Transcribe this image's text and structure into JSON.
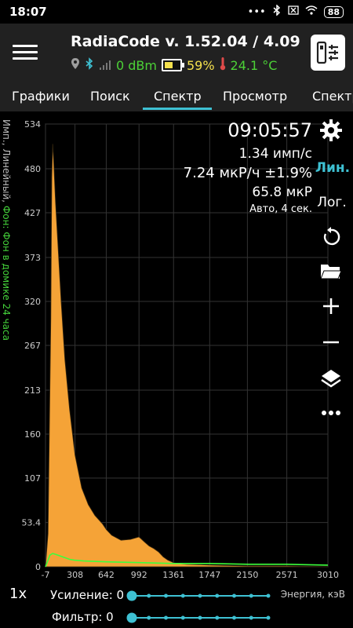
{
  "status": {
    "time": "18:07",
    "icons": [
      "more-dots-icon",
      "bluetooth-icon",
      "close-box-icon",
      "wifi-icon",
      "battery-icon"
    ],
    "battery": "88"
  },
  "appbar": {
    "title": "RadiaCode v. 1.52.04 / 4.09",
    "signal": "0 dBm",
    "battery": "59%",
    "temperature": "24.1 °C",
    "icons": [
      "location-pin-icon",
      "bluetooth-icon",
      "signal-bars-icon",
      "battery-icon",
      "thermometer-icon",
      "device-settings-icon"
    ]
  },
  "tabs": [
    "Графики",
    "Поиск",
    "Спектр",
    "Просмотр",
    "Спектр"
  ],
  "active_tab": 2,
  "spectrum": {
    "vertical_label_a": "Имп., Линейный, ",
    "vertical_label_b": "Фон: Фон в домике 24 часа",
    "time": "09:05:57",
    "count_rate": "1.34 имп/с",
    "dose_rate": "7.24 мкР/ч ±1.9%",
    "total_dose": "65.8 мкР",
    "mode": "Авто, 4 сек.",
    "side": {
      "lin": "Лин.",
      "log": "Лог.",
      "icons": [
        "gear-icon",
        "refresh-icon",
        "folder-icon",
        "plus-icon",
        "minus-icon",
        "layers-icon",
        "more-icon"
      ]
    }
  },
  "chart_data": {
    "type": "area",
    "xlabel": "Энергия, кэВ",
    "y_ticks": [
      0,
      53.4,
      107,
      160,
      213,
      267,
      320,
      373,
      427,
      480,
      534
    ],
    "x_ticks": [
      -7,
      308,
      642,
      992,
      1361,
      1747,
      2150,
      2571,
      3010
    ],
    "ylim": [
      0,
      534
    ],
    "xlim": [
      -7,
      3010
    ],
    "grid": true,
    "series": [
      {
        "color": "#f5a337",
        "x": [
          -7,
          20,
          50,
          60,
          70,
          80,
          100,
          130,
          160,
          200,
          250,
          308,
          380,
          450,
          520,
          600,
          642,
          700,
          800,
          900,
          992,
          1050,
          1100,
          1150,
          1200,
          1250,
          1300,
          1361,
          1400,
          1500,
          1747,
          2150,
          2571,
          3010
        ],
        "y": [
          0,
          40,
          300,
          470,
          510,
          490,
          440,
          380,
          320,
          250,
          190,
          135,
          95,
          75,
          62,
          52,
          45,
          38,
          32,
          33,
          36,
          30,
          25,
          22,
          18,
          12,
          8,
          5,
          4,
          3,
          2,
          1,
          1,
          0
        ]
      },
      {
        "color": "#3cff3c",
        "x": [
          -7,
          20,
          40,
          70,
          100,
          150,
          200,
          250,
          300,
          400,
          642,
          992,
          1361,
          1747,
          2150,
          2571,
          3010
        ],
        "y": [
          0,
          8,
          14,
          16,
          15,
          13,
          11,
          9,
          8,
          7,
          6,
          5,
          4,
          4,
          3,
          3,
          2
        ]
      }
    ]
  },
  "controls": {
    "gain_x": "1x",
    "gain_label": "Усиление: 0",
    "filter_label": "Фильтр: 0",
    "gain_value": 0,
    "filter_value": 0
  }
}
